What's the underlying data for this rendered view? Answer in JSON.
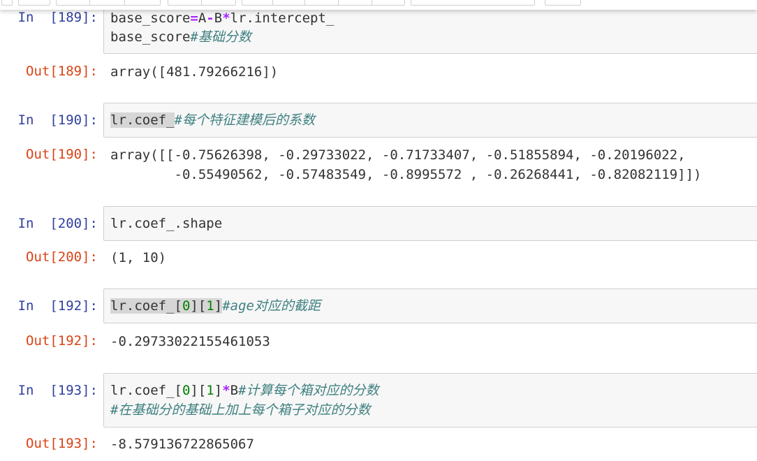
{
  "cells": {
    "c189": {
      "in_prompt": "In  [189]:",
      "line1": {
        "a": "base_score",
        "op_eq": "=",
        "b": "A",
        "op_minus": "-",
        "c": "B",
        "op_mul": "*",
        "d": "lr.intercept_"
      },
      "line2": {
        "a": "base_score",
        "comment": "#基础分数"
      },
      "out_prompt": "Out[189]:",
      "output": "array([481.79266216])"
    },
    "c190": {
      "in_prompt": "In  [190]:",
      "line1": {
        "a": "lr.coef_",
        "comment": "#每个特征建模后的系数"
      },
      "out_prompt": "Out[190]:",
      "output_line1": "array([[-0.75626398, -0.29733022, -0.71733407, -0.51855894, -0.20196022,",
      "output_line2": "        -0.55490562, -0.57483549, -0.8995572 , -0.26268441, -0.82082119]])"
    },
    "c200": {
      "in_prompt": "In  [200]:",
      "line1": {
        "a": "lr.coef_.shape"
      },
      "out_prompt": "Out[200]:",
      "output": "(1, 10)"
    },
    "c192": {
      "in_prompt": "In  [192]:",
      "line1": {
        "a": "lr.coef_[",
        "n0": "0",
        "b": "][",
        "n1": "1",
        "c": "]",
        "comment": "#age对应的截距"
      },
      "out_prompt": "Out[192]:",
      "output": "-0.29733022155461053"
    },
    "c193": {
      "in_prompt": "In  [193]:",
      "line1": {
        "a": "lr.coef_[",
        "n0": "0",
        "b": "][",
        "n1": "1",
        "c": "]",
        "op_mul": "*",
        "d": "B",
        "comment": "#计算每个箱对应的分数"
      },
      "line2": {
        "comment": "#在基础分的基础上加上每个箱子对应的分数"
      },
      "out_prompt": "Out[193]:",
      "output": "-8.579136722865067"
    }
  }
}
